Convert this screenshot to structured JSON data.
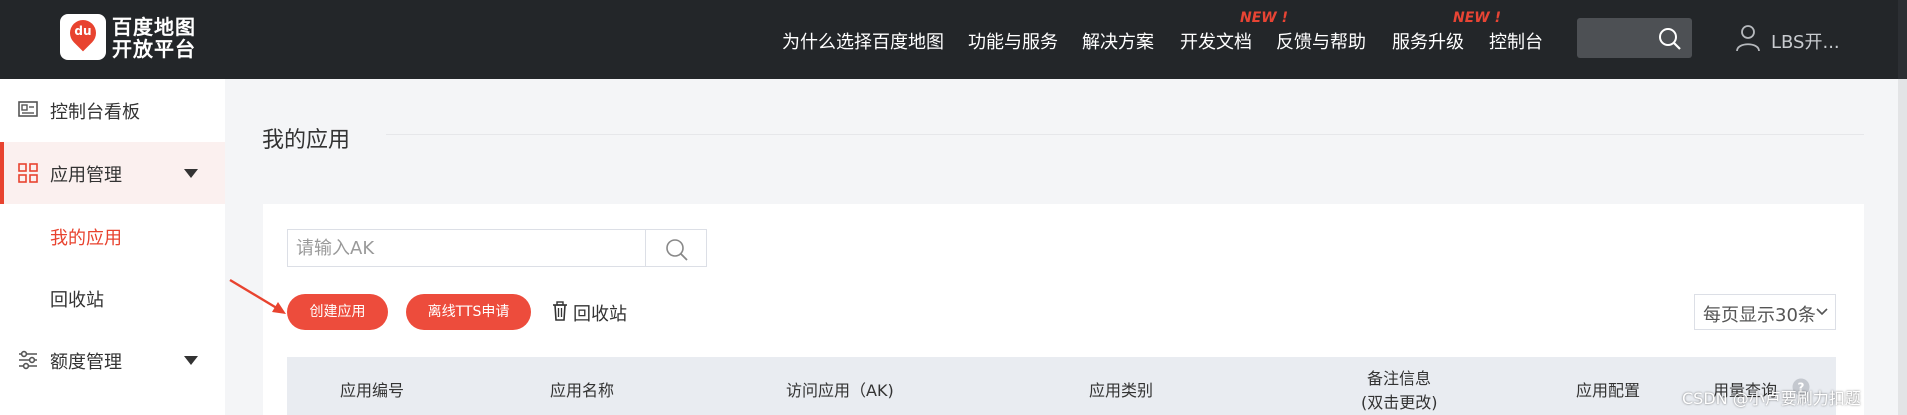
{
  "header": {
    "logo_mark": "du",
    "logo_line1": "百度地图",
    "logo_line2": "开放平台",
    "nav": [
      {
        "label": "为什么选择百度地图"
      },
      {
        "label": "功能与服务"
      },
      {
        "label": "解决方案"
      },
      {
        "label": "开发文档",
        "badge": "NEW !"
      },
      {
        "label": "反馈与帮助"
      },
      {
        "label": "服务升级",
        "badge": "NEW !"
      },
      {
        "label": "控制台"
      }
    ],
    "search_icon": "search-icon",
    "user_name": "LBS开..."
  },
  "sidebar": {
    "items": [
      {
        "label": "控制台看板",
        "icon": "dashboard-icon"
      },
      {
        "label": "应用管理",
        "icon": "grid-icon",
        "expanded": true
      },
      {
        "label": "我的应用",
        "active": true
      },
      {
        "label": "回收站"
      },
      {
        "label": "额度管理",
        "icon": "sliders-icon"
      }
    ]
  },
  "main": {
    "page_title": "我的应用",
    "search": {
      "placeholder": "请输入AK"
    },
    "create_button": "创建应用",
    "tts_button": "离线TTS申请",
    "recycle_link": "回收站",
    "page_size": "每页显示30条",
    "table": {
      "columns": [
        "应用编号",
        "应用名称",
        "访问应用（AK)",
        "应用类别",
        "备注信息",
        "(双击更改)",
        "应用配置",
        "用量查询"
      ]
    }
  },
  "watermark": "CSDN @小卢要刷力扣题",
  "colors": {
    "accent": "#e8432f",
    "topbar": "#232629",
    "button": "#ed4c3c"
  }
}
